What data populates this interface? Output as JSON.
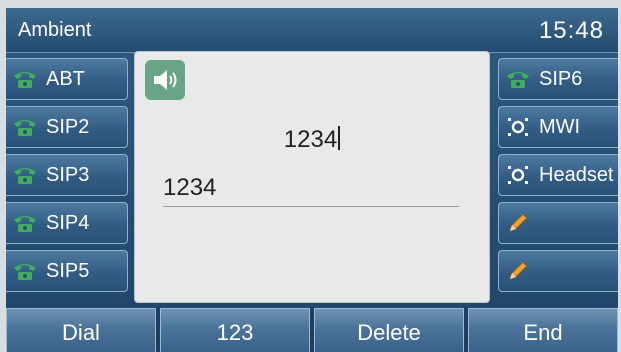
{
  "header": {
    "title": "Ambient",
    "time": "15:48"
  },
  "left_keys": [
    {
      "label": "ABT",
      "icon": "phone-icon"
    },
    {
      "label": "SIP2",
      "icon": "phone-icon"
    },
    {
      "label": "SIP3",
      "icon": "phone-icon"
    },
    {
      "label": "SIP4",
      "icon": "phone-icon"
    },
    {
      "label": "SIP5",
      "icon": "phone-icon"
    }
  ],
  "right_keys": [
    {
      "label": "SIP6",
      "icon": "phone-icon"
    },
    {
      "label": "MWI",
      "icon": "blf-icon"
    },
    {
      "label": "Headset",
      "icon": "blf-icon"
    },
    {
      "label": "",
      "icon": "pencil-icon"
    },
    {
      "label": "",
      "icon": "pencil-icon"
    }
  ],
  "dial": {
    "input": "1234",
    "suggestion": "1234",
    "mode_icon": "speaker-icon"
  },
  "softkeys": [
    "Dial",
    "123",
    "Delete",
    "End"
  ],
  "colors": {
    "phone_icon": "#3fae5c",
    "speaker_badge": "#6aa486",
    "pencil": "#e3a23a"
  }
}
